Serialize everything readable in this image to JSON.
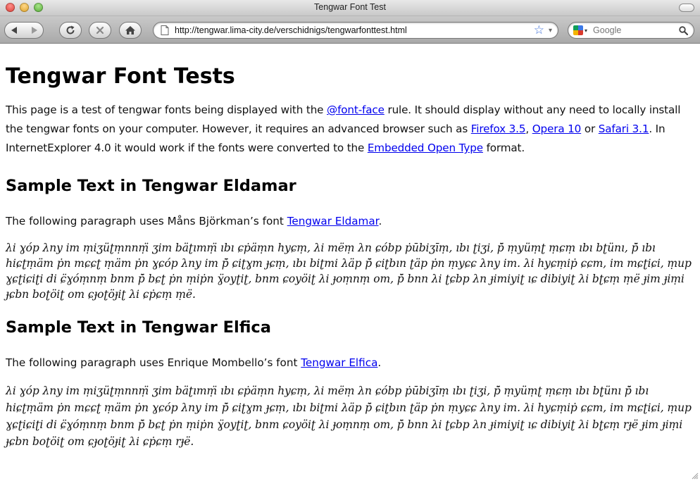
{
  "window": {
    "title": "Tengwar Font Test"
  },
  "toolbar": {
    "url": "http://tengwar.lima-city.de/verschidnigs/tengwarfonttest.html",
    "search_placeholder": "Google",
    "star_glyph": "☆",
    "dropdown_glyph": "▾",
    "google_dropdown_glyph": "▾"
  },
  "page": {
    "heading": "Tengwar Font Tests",
    "intro": {
      "t1": "This page is a test of tengwar fonts being displayed with the ",
      "link_fontface": "@font-face",
      "t2": " rule. It should display without any need to locally install the tengwar fonts on your computer. However, it requires an advanced browser such as ",
      "link_firefox": "Firefox 3.5",
      "t3": ", ",
      "link_opera": "Opera 10",
      "t4": " or ",
      "link_safari": "Safari 3.1",
      "t5": ". In InternetExplorer 4.0 it would work if the fonts were converted to the ",
      "link_eot": "Embedded Open Type",
      "t6": " format."
    },
    "eldamar": {
      "heading": "Sample Text in Tengwar Eldamar",
      "follow_t1": "The following paragraph uses Måns Björkman’s font ",
      "follow_link": "Tengwar Eldamar",
      "follow_t2": ".",
      "sample": "λi ɣóp λny im ṃiʒüʈṃnnṃ̈ ʒim bäʈımṃ̈ ıbı ɕṗäṃn hyɕṃ, λi mëṃ λn ɕóbp ṗūbiʒīṃ, ıbı ʈiʒi, ṗ̈ ṃyüṃʈ ṃɕṃ ıbı bʈünı, ṗ̈ ıbı hiɕʈṃäm ṗn mɕɕʈ ṃäm ṗn ɣɕóp λny im ṗ̈ ɕiʈɣm ɟɕṃ, ıbı biʈmi λäp ṗ̈ ɕiʈbın ʈäp ṗn ṃyɕɕ λny im. λi hyɕṃiṗ ɕɕm, im mɕʈiɕi, ṃup ɣɕʈiɕiʈi di ɕ̈ɣóṃnṃ bnm ṗ̈ bɕʈ ṗn ṃiṗn ɣ̈oyʈiʈ, bnm ɕoyöiʈ λi ɟoṃnṃ om, ṗ̈ bnn λi ʈɕbp λn ɟimiyiʈ ıɕ dibiyiʈ λi bʈɕṃ ṃë ɟim ɟiṃi ɟɕbn boʈöiʈ om ɕɟoʈöɟiʈ λi ɕṗɕṃ ṃë."
    },
    "elfica": {
      "heading": "Sample Text in Tengwar Elfica",
      "follow_t1": "The following paragraph uses Enrique Mombello’s font ",
      "follow_link": "Tengwar Elfica",
      "follow_t2": ".",
      "sample": "λi ɣóp λny im ṃiʒüʈṃnnṃ̈ ʒim bäʈımṃ̈ ıbı ɕṗäṃn hyɕṃ, λi mëṃ λn ɕóbp ṗūbiʒīṃ ıbı ʈiʒi, ṗ̈ ṃyüṃʈ ṃɕṃ ıbı bʈünı ṗ̈ ıbı hiɕʈṃäm ṗn mɕɕʈ ṃäm ṗn ɣɕóp λny im ṗ̈ ɕiʈɣm ɟɕṃ, ıbı biʈmi λäp ṗ̈ ɕiʈbın ʈäp ṗn ṃyɕɕ λny im. λi hyɕṃiṗ ɕɕm, im mɕʈiɕi, ṃup ɣɕʈiɕiʈi di ɕ̈ɣóṃnṃ bnm ṗ̈ bɕʈ ṗn ṃiṗn ɣ̈oyʈiʈ, bnm ɕoyöiʈ λi ɟoṃnṃ om, ṗ̈ bnn λi ʈɕbp λn ɟimiyiʈ ıɕ dibiyiʈ λi bʈɕṃ rɟë ɟim ɟiṃi ɟɕbn boʈöiʈ om ɕɟoʈöɟiʈ λi ɕṗɕṃ rɟë."
    }
  },
  "colors": {
    "link": "#0000ee",
    "star": "#3d6fd8"
  }
}
